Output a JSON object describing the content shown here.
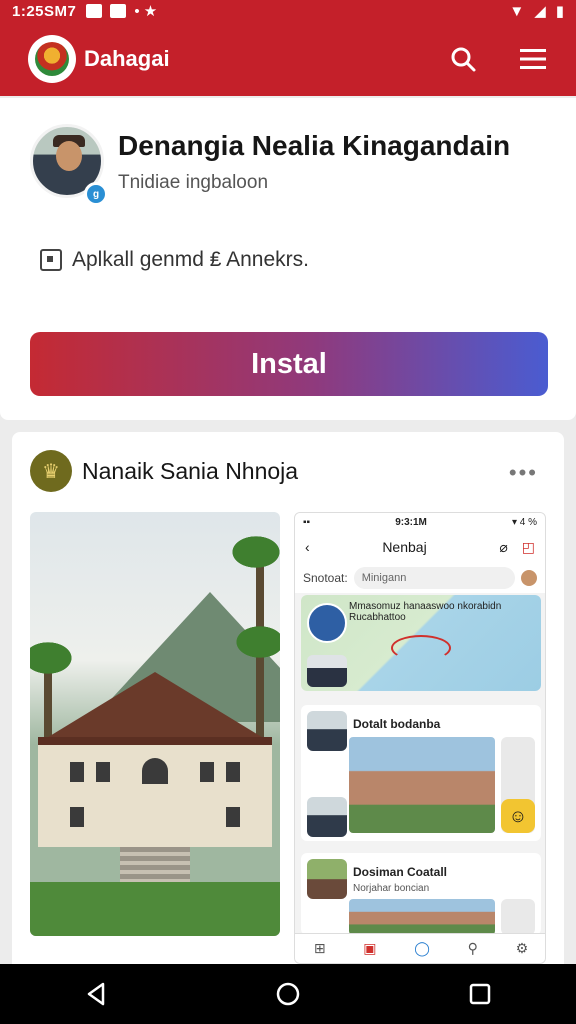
{
  "status_bar": {
    "time": "1:25SM7",
    "icons": [
      "notification-icon",
      "mail-icon",
      "wifi-icon",
      "signal-icon",
      "battery-icon"
    ]
  },
  "app_bar": {
    "title": "Dahagai",
    "icons": [
      "app-logo",
      "search-icon",
      "menu-icon"
    ],
    "color": "#c4202a"
  },
  "profile": {
    "name": "Denangia Nealia Kinagandain",
    "subtitle": "Tnidiae ingbaloon",
    "info": "Aplkall genmd ₤ Annekrs.",
    "install_label": "Instal",
    "badge": "g"
  },
  "post": {
    "title": "Nanaik Sania Nhnoja",
    "more": "•••",
    "phone": {
      "time": "9:3:1M",
      "signal": "▾ 4 %",
      "title": "Nenbaj",
      "search_label": "Snotoat:",
      "search_placeholder": "Minigann",
      "map_title": "Mmasomuz hanaaswoo nkorabidn Rucabhattoo",
      "item1_title": "Dotalt bodanba",
      "item2_title": "Dosiman Coatall",
      "item2_sub": "Norjahar boncian",
      "tabs": [
        "home-tab",
        "app-tab",
        "chat-tab",
        "profile-tab",
        "settings-tab"
      ]
    }
  },
  "nav": {
    "icons": [
      "back-icon",
      "home-icon",
      "recents-icon"
    ]
  },
  "colors": {
    "brand_red": "#c4202a",
    "install_gradient_start": "#c42a33",
    "install_gradient_end": "#4a5cd1"
  }
}
